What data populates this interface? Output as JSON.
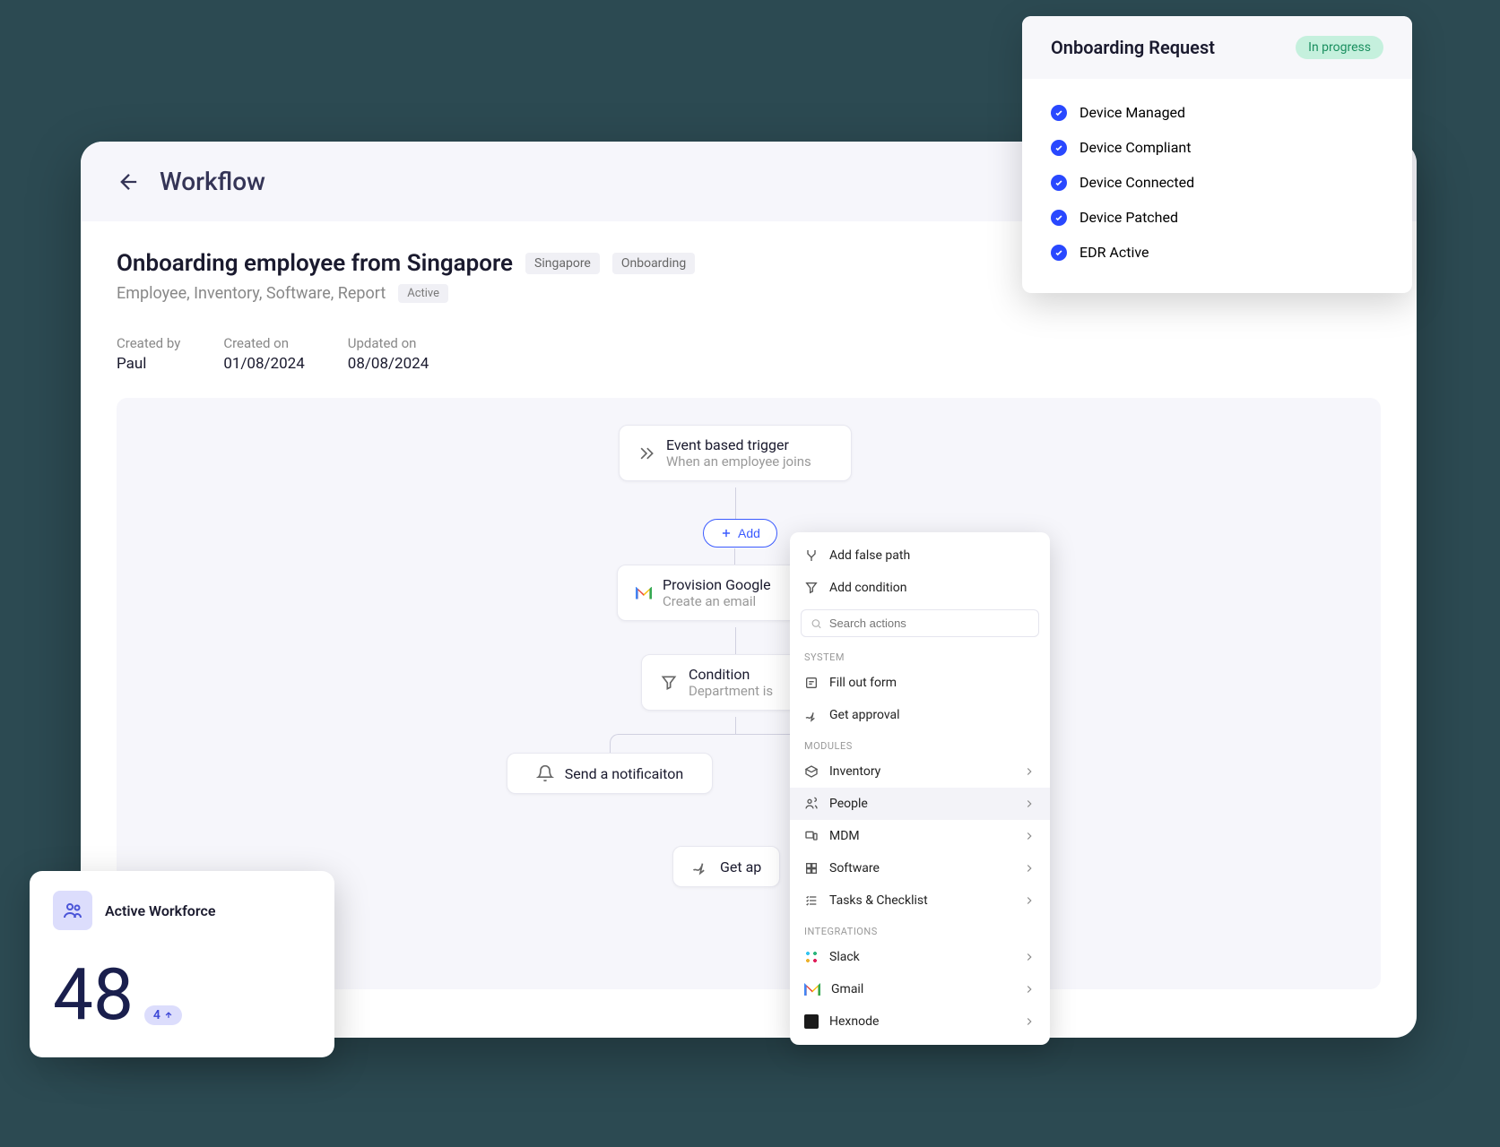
{
  "header": {
    "title": "Workflow"
  },
  "workflow": {
    "title": "Onboarding employee from Singapore",
    "tags": [
      "Singapore",
      "Onboarding"
    ],
    "subtitle": "Employee, Inventory, Software, Report",
    "status": "Active",
    "meta": {
      "created_by_label": "Created by",
      "created_by_value": "Paul",
      "created_on_label": "Created on",
      "created_on_value": "01/08/2024",
      "updated_on_label": "Updated on",
      "updated_on_value": "08/08/2024"
    }
  },
  "nodes": {
    "trigger": {
      "title": "Event based trigger",
      "sub": "When an employee joins"
    },
    "add_label": "Add",
    "provision": {
      "title": "Provision Google",
      "sub": "Create an email"
    },
    "condition": {
      "title": "Condition",
      "sub": "Department is"
    },
    "notification": {
      "title": "Send a notificaiton"
    },
    "approval": {
      "title": "Get ap"
    }
  },
  "action_panel": {
    "add_false_path": "Add false path",
    "add_condition": "Add condition",
    "search_placeholder": "Search actions",
    "sections": {
      "system_label": "SYSTEM",
      "system": [
        "Fill out form",
        "Get approval"
      ],
      "modules_label": "MODULES",
      "modules": [
        "Inventory",
        "People",
        "MDM",
        "Software",
        "Tasks & Checklist"
      ],
      "integrations_label": "INTEGRATIONS",
      "integrations": [
        "Slack",
        "Gmail",
        "Hexnode"
      ]
    }
  },
  "onboarding": {
    "title": "Onboarding Request",
    "status": "In progress",
    "items": [
      "Device Managed",
      "Device Compliant",
      "Device Connected",
      "Device Patched",
      "EDR Active"
    ]
  },
  "workforce": {
    "title": "Active Workforce",
    "value": "48",
    "delta": "4"
  }
}
